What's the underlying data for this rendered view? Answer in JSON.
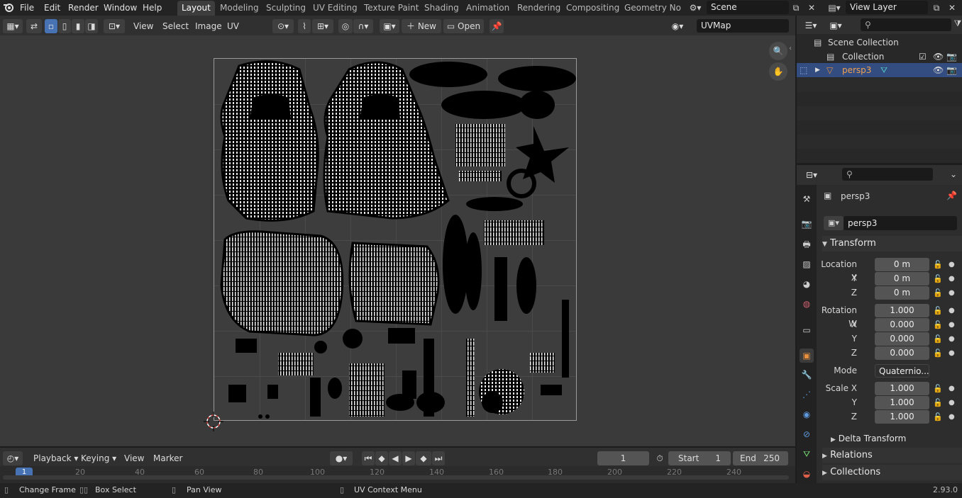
{
  "app": {
    "version": "2.93.0"
  },
  "menubar": {
    "items": [
      "File",
      "Edit",
      "Render",
      "Window",
      "Help"
    ]
  },
  "workspace_tabs": [
    {
      "label": "Layout",
      "active": true
    },
    {
      "label": "Modeling"
    },
    {
      "label": "Sculpting"
    },
    {
      "label": "UV Editing"
    },
    {
      "label": "Texture Paint"
    },
    {
      "label": "Shading"
    },
    {
      "label": "Animation"
    },
    {
      "label": "Rendering"
    },
    {
      "label": "Compositing"
    },
    {
      "label": "Geometry Nod"
    }
  ],
  "scene": {
    "name": "Scene"
  },
  "view_layer": {
    "name": "View Layer"
  },
  "uv_editor": {
    "menus": [
      "View",
      "Select",
      "Image",
      "UV"
    ],
    "new_label": "New",
    "open_label": "Open",
    "uvmap": "UVMap"
  },
  "outliner": {
    "search_placeholder": "",
    "rows": [
      {
        "label": "Scene Collection"
      },
      {
        "label": "Collection"
      },
      {
        "label": "persp3",
        "selected": true
      }
    ]
  },
  "properties": {
    "object_name": "persp3",
    "data_name": "persp3",
    "transform_label": "Transform",
    "location": {
      "label": "Location X",
      "x": "0 m",
      "y": "0 m",
      "z": "0 m"
    },
    "rotation": {
      "label": "Rotation W",
      "w": "1.000",
      "x": "0.000",
      "y": "0.000",
      "z": "0.000"
    },
    "mode_label": "Mode",
    "mode_value": "Quaternio...",
    "scale": {
      "label": "Scale X",
      "x": "1.000",
      "y": "1.000",
      "z": "1.000"
    },
    "axis_y": "Y",
    "axis_z": "Z",
    "axis_x": "X",
    "delta_transform": "Delta Transform",
    "relations": "Relations",
    "collections": "Collections"
  },
  "timeline": {
    "menus": [
      "Playback",
      "Keying",
      "View",
      "Marker"
    ],
    "current_frame": "1",
    "start_label": "Start",
    "start_value": "1",
    "end_label": "End",
    "end_value": "250",
    "ruler_ticks": [
      "1",
      "20",
      "40",
      "60",
      "80",
      "100",
      "120",
      "140",
      "160",
      "180",
      "200",
      "220",
      "240"
    ]
  },
  "statusbar": {
    "items": [
      "Change Frame",
      "Box Select",
      "Pan View",
      "UV Context Menu"
    ]
  },
  "colors": {
    "accent": "#4772b3",
    "selection": "#334d80",
    "orange": "#e8903c"
  }
}
